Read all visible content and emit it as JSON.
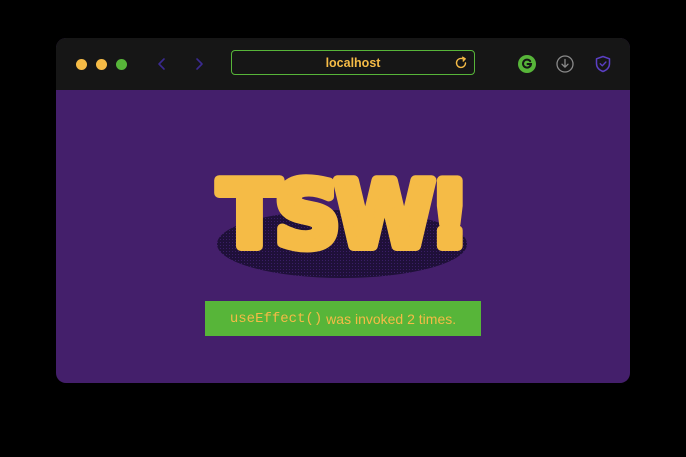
{
  "browser": {
    "address": "localhost",
    "icons": {
      "back": "chevron-left-icon",
      "forward": "chevron-right-icon",
      "reload": "reload-icon",
      "extension_1": "grammarly-icon",
      "extension_2": "download-icon",
      "extension_3": "shield-icon"
    }
  },
  "page": {
    "logo_text": "TSW!",
    "message_code": "useEffect()",
    "message_text": " was invoked 2 times."
  },
  "colors": {
    "window_bg": "#441f6b",
    "toolbar_bg": "#161616",
    "accent_yellow": "#f5bb46",
    "accent_green": "#57b539",
    "logo_shadow": "#1f1039"
  }
}
